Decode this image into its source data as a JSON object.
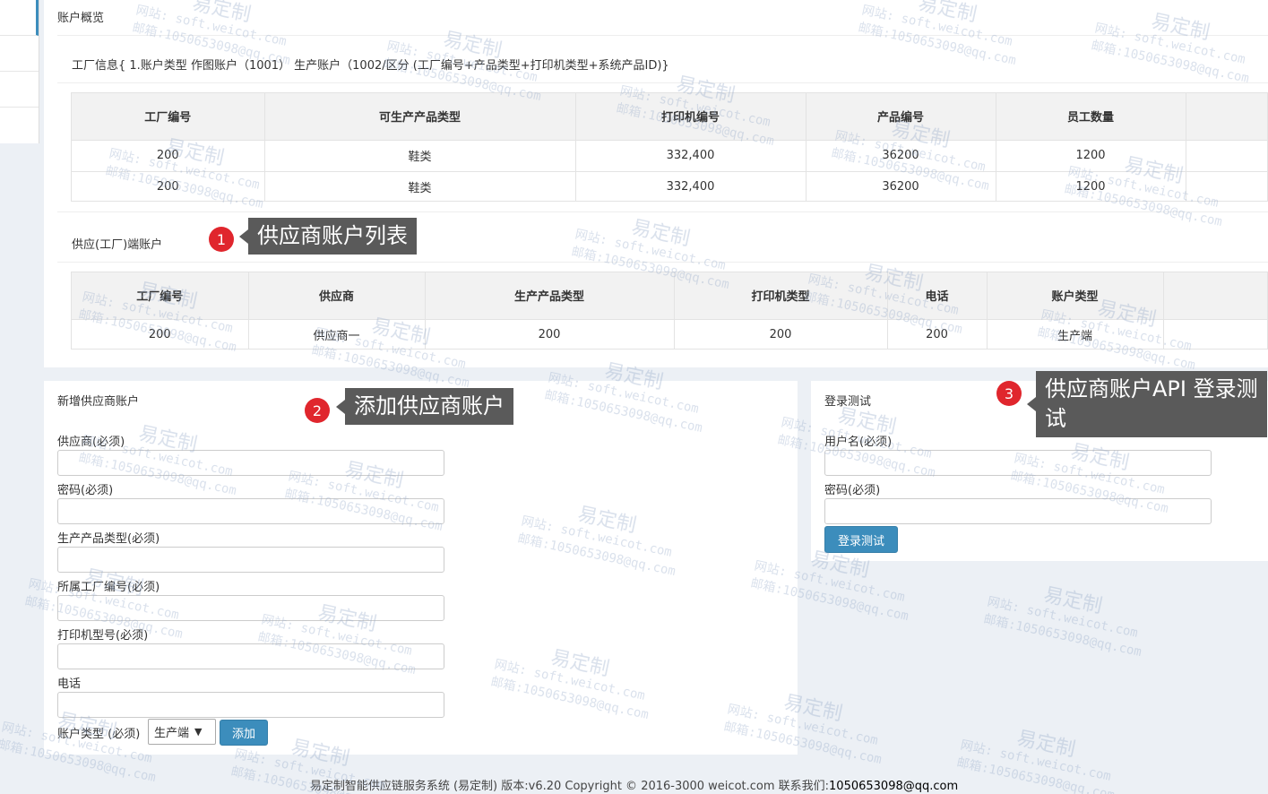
{
  "page": {
    "title": "账户概览"
  },
  "factory": {
    "info": "工厂信息{ 1.账户类型 作图账户（1001） 生产账户（1002/区分 (工厂编号+产品类型+打印机类型+系统产品ID)}",
    "columns": [
      "工厂编号",
      "可生产产品类型",
      "打印机编号",
      "产品编号",
      "员工数量"
    ],
    "rows": [
      [
        "200",
        "鞋类",
        "332,400",
        "36200",
        "1200"
      ],
      [
        "200",
        "鞋类",
        "332,400",
        "36200",
        "1200"
      ]
    ]
  },
  "supplier": {
    "title": "供应(工厂)端账户",
    "columns": [
      "工厂编号",
      "供应商",
      "生产产品类型",
      "打印机类型",
      "电话",
      "账户类型"
    ],
    "rows": [
      [
        "200",
        "供应商一",
        "200",
        "200",
        "200",
        "生产端"
      ]
    ]
  },
  "add_form": {
    "title": "新增供应商账户",
    "fields": [
      {
        "label": "供应商(必须)"
      },
      {
        "label": "密码(必须)"
      },
      {
        "label": "生产产品类型(必须)"
      },
      {
        "label": "所属工厂编号(必须)"
      },
      {
        "label": "打印机型号(必须)"
      },
      {
        "label": "电话"
      }
    ],
    "account_type_label": "账户类型 (必须)",
    "account_type_value": "生产端",
    "submit_label": "添加"
  },
  "login_test": {
    "title": "登录测试",
    "username_label": "用户名(必须)",
    "password_label": "密码(必须)",
    "button_label": "登录测试"
  },
  "callouts": [
    {
      "number": "1",
      "text": "供应商账户列表"
    },
    {
      "number": "2",
      "text": "添加供应商账户"
    },
    {
      "number": "3",
      "text": "供应商账户API 登录测试"
    }
  ],
  "footer": {
    "text": "易定制智能供应链服务系统 (易定制) 版本:v6.20 Copyright © 2016-3000 weicot.com 联系我们:",
    "email": "1050653098@qq.com"
  },
  "watermark": {
    "brand": "易定制",
    "site": "网站: soft.weicot.com",
    "mail": "邮箱:1050653098@qq.com"
  }
}
